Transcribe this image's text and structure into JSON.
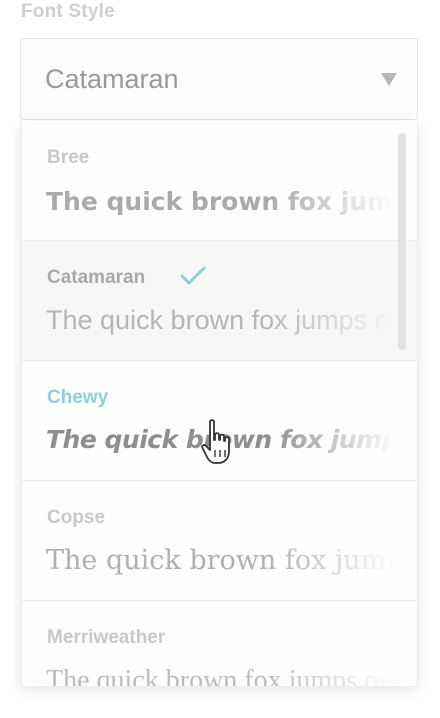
{
  "field": {
    "label": "Font Style",
    "selected_value": "Catamaran",
    "chevron_icon": "chevron-down-icon"
  },
  "dropdown": {
    "options": [
      {
        "name": "Bree",
        "preview": "The quick brown fox jumps over the lazy dog",
        "selected": false,
        "hovered": false
      },
      {
        "name": "Catamaran",
        "preview": "The quick brown fox jumps over the lazy dog",
        "selected": true,
        "hovered": false
      },
      {
        "name": "Chewy",
        "preview": "The quick brown fox jumps over the lazy dog",
        "selected": false,
        "hovered": true
      },
      {
        "name": "Copse",
        "preview": "The quick brown fox jumps over the lazy dog",
        "selected": false,
        "hovered": false
      },
      {
        "name": "Merriweather",
        "preview": "The quick brown fox jumps over the lazy dog",
        "selected": false,
        "hovered": false
      }
    ],
    "check_icon": "checkmark-icon",
    "cursor_icon": "hand-pointer-icon"
  },
  "colors": {
    "accent": "#8fd0d6",
    "label": "#cfcfcf",
    "border": "#e6e6e6"
  }
}
